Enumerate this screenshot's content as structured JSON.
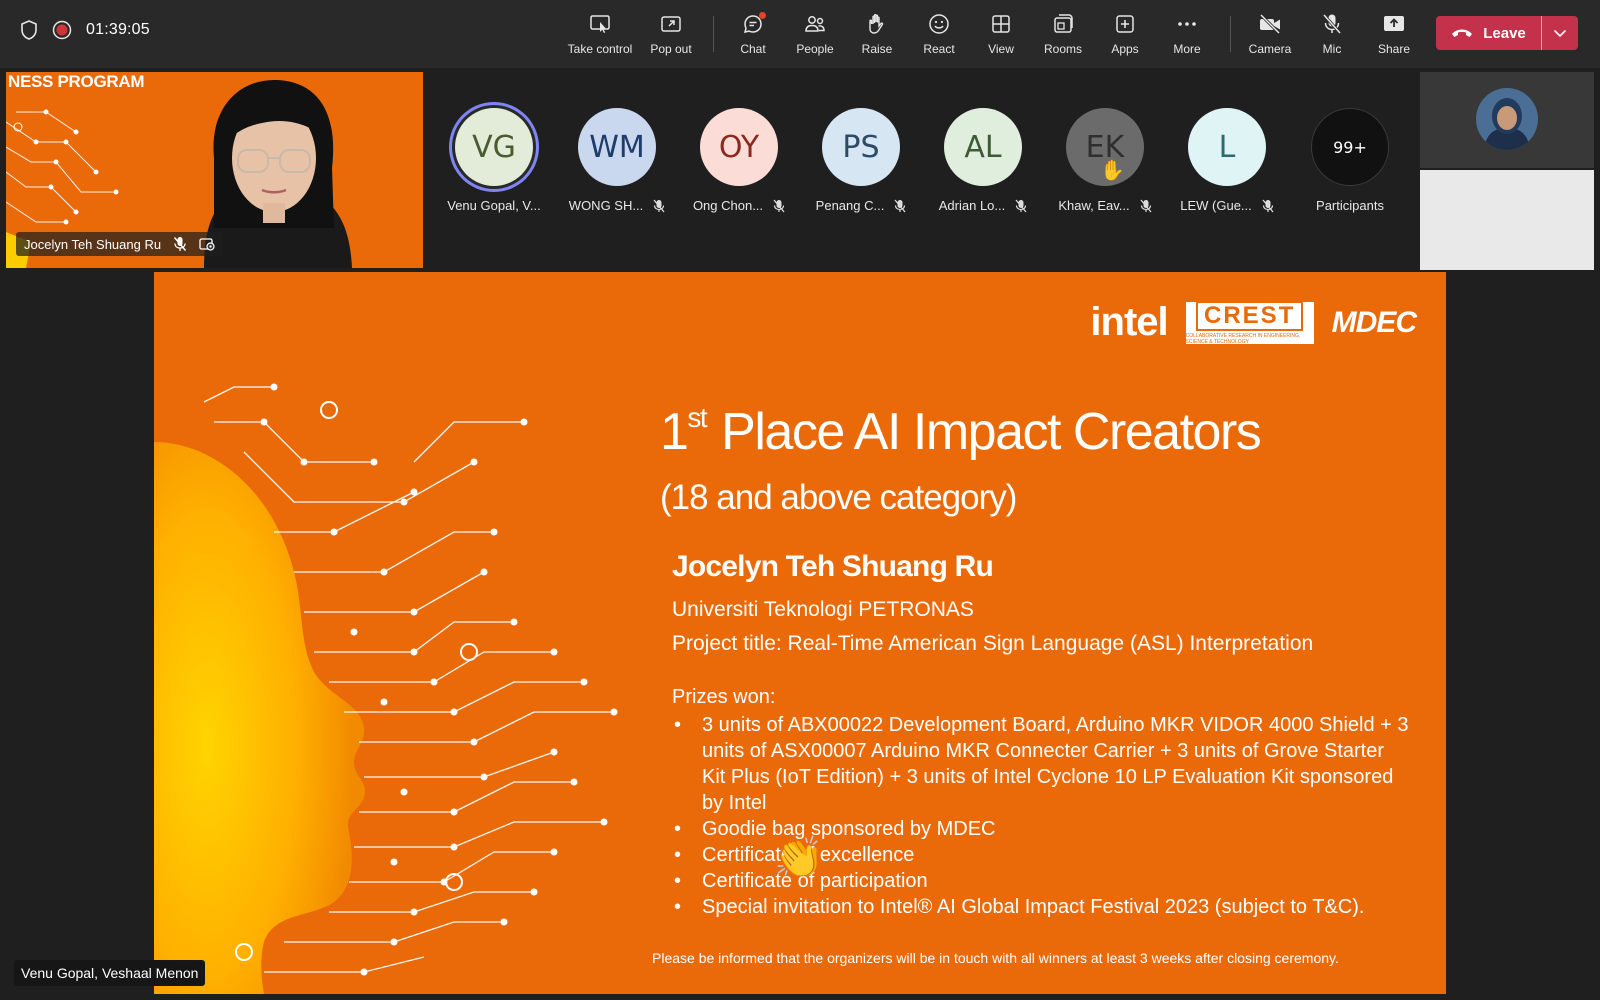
{
  "topbar": {
    "timer": "01:39:05",
    "buttons": {
      "take_control": "Take control",
      "pop_out": "Pop out",
      "chat": "Chat",
      "people": "People",
      "raise": "Raise",
      "react": "React",
      "view": "View",
      "rooms": "Rooms",
      "apps": "Apps",
      "more": "More",
      "camera": "Camera",
      "mic": "Mic",
      "share": "Share"
    },
    "leave_label": "Leave",
    "leave_color": "#c4314b"
  },
  "self_video": {
    "banner_text": "NESS PROGRAM",
    "name": "Jocelyn Teh Shuang Ru"
  },
  "participants": [
    {
      "initials": "VG",
      "name": "Venu Gopal, V...",
      "bg": "#e3ecd9",
      "fg": "#4b5b2f",
      "speaking": true
    },
    {
      "initials": "WM",
      "name": "WONG SH...",
      "bg": "#c9d8ef",
      "fg": "#1f3d6b",
      "muted": true
    },
    {
      "initials": "OY",
      "name": "Ong Chon...",
      "bg": "#fbdcd6",
      "fg": "#8a2a1e",
      "muted": true
    },
    {
      "initials": "PS",
      "name": "Penang C...",
      "bg": "#d7e6f3",
      "fg": "#2d4b66",
      "muted": true
    },
    {
      "initials": "AL",
      "name": "Adrian Lo...",
      "bg": "#dfeedd",
      "fg": "#3f5a36",
      "muted": true
    },
    {
      "initials": "EK",
      "name": "Khaw, Eav...",
      "bg": "#6b6b6b",
      "fg": "#2f2f2f",
      "muted": true,
      "hand_raised": true
    },
    {
      "initials": "L",
      "name": "LEW (Gue...",
      "bg": "#dff4f5",
      "fg": "#2b6b70",
      "muted": true
    }
  ],
  "participants_more": {
    "count": "99+",
    "label": "Participants"
  },
  "slide": {
    "logos": {
      "intel": "intel",
      "crest": "CREST",
      "crest_tagline": "COLLABORATIVE RESEARCH IN ENGINEERING, SCIENCE & TECHNOLOGY",
      "mdec": "MDEC"
    },
    "title_ordinal": "1",
    "title_suffix": "st",
    "title_rest": "Place AI Impact Creators",
    "subtitle": "(18 and above category)",
    "winner_name": "Jocelyn Teh Shuang Ru",
    "university": "Universiti Teknologi PETRONAS",
    "project_title": "Project title: Real-Time American Sign Language (ASL) Interpretation",
    "prizes_heading": "Prizes won:",
    "prizes": [
      "3 units of ABX00022 Development Board, Arduino MKR VIDOR 4000 Shield + 3 units of ASX00007 Arduino MKR Connecter Carrier + 3 units of Grove Starter Kit Plus (IoT Edition) + 3 units of Intel Cyclone 10 LP Evaluation Kit sponsored by Intel",
      "Goodie bag sponsored by MDEC",
      "Certificate of excellence",
      "Certificate of participation",
      "Special invitation to Intel® AI Global Impact Festival 2023 (subject to T&C)."
    ],
    "note": "Please be informed that the organizers will be in touch with all winners at least 3 weeks after closing ceremony.",
    "background_color": "#ea6a0a"
  },
  "presenter_name": "Venu Gopal, Veshaal Menon"
}
